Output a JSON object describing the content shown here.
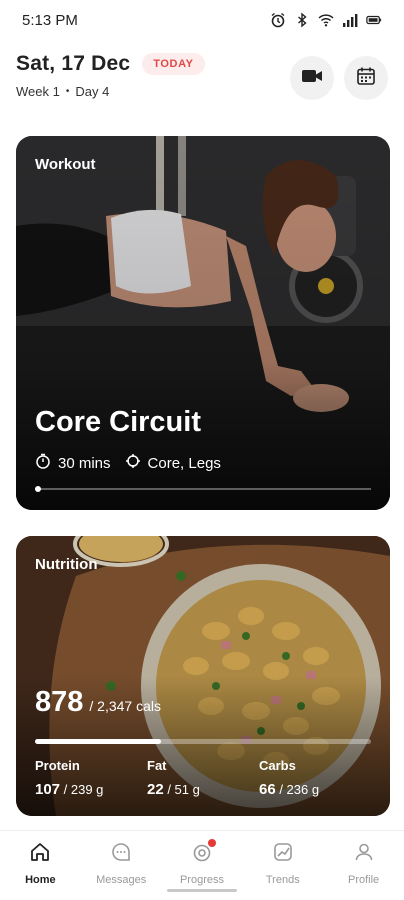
{
  "status_bar": {
    "time": "5:13 PM",
    "icons": [
      "alarm-icon",
      "bluetooth-icon",
      "wifi-icon",
      "signal-icon",
      "battery-icon"
    ]
  },
  "header": {
    "date": "Sat, 17 Dec",
    "badge": "TODAY",
    "week": "Week 1",
    "separator": "•",
    "day": "Day 4"
  },
  "workout": {
    "label": "Workout",
    "title": "Core Circuit",
    "duration": "30 mins",
    "focus": "Core, Legs",
    "progress_fraction": 0.0
  },
  "nutrition": {
    "label": "Nutrition",
    "calories": "878",
    "calories_total": "/ 2,347 cals",
    "progress_fraction": 0.374,
    "macros": [
      {
        "label": "Protein",
        "value": "107",
        "total": "/ 239 g"
      },
      {
        "label": "Fat",
        "value": "22",
        "total": "/ 51 g"
      },
      {
        "label": "Carbs",
        "value": "66",
        "total": "/ 236 g"
      }
    ]
  },
  "nav": {
    "items": [
      {
        "label": "Home",
        "icon": "home-icon",
        "active": true
      },
      {
        "label": "Messages",
        "icon": "messages-icon",
        "active": false
      },
      {
        "label": "Progress",
        "icon": "progress-icon",
        "active": false,
        "notification": true
      },
      {
        "label": "Trends",
        "icon": "trends-icon",
        "active": false
      },
      {
        "label": "Profile",
        "icon": "profile-icon",
        "active": false
      }
    ]
  },
  "colors": {
    "accent_red": "#e04848",
    "badge_bg": "#fdecec",
    "text_dark": "#222222"
  }
}
